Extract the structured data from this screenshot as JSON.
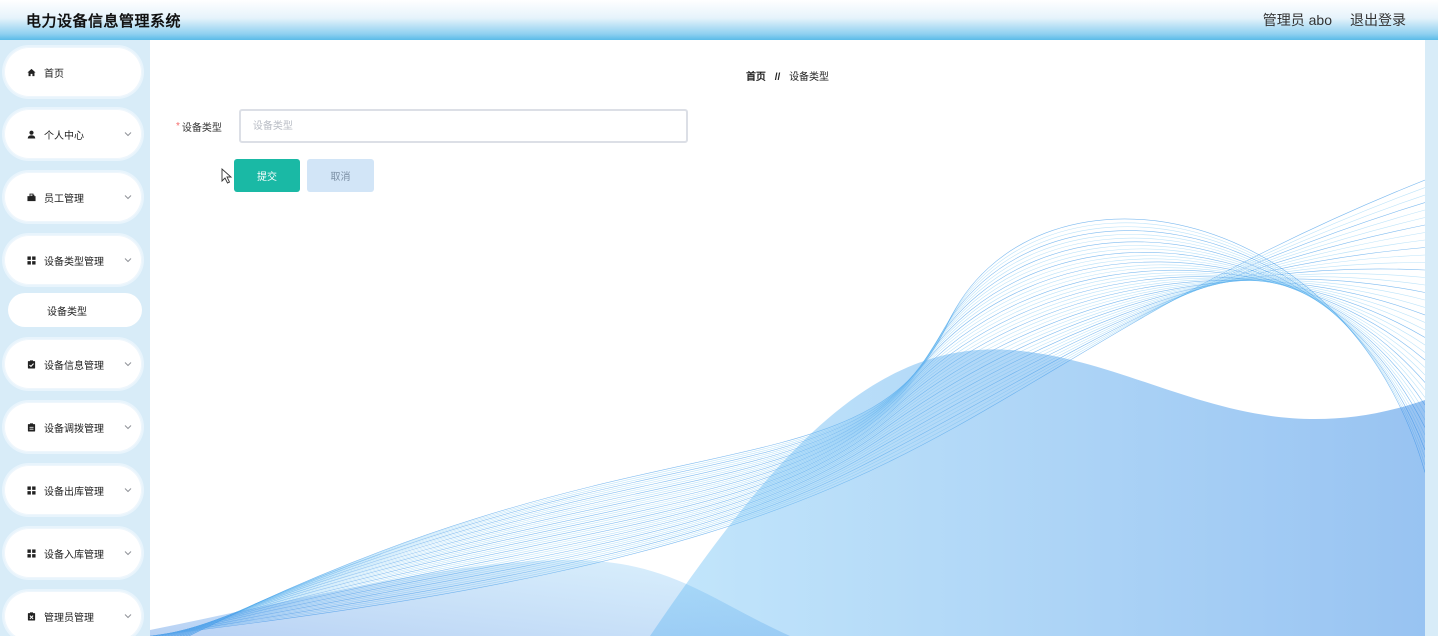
{
  "header": {
    "app_title": "电力设备信息管理系统",
    "user_label": "管理员 abo",
    "logout_label": "退出登录"
  },
  "sidebar": {
    "items": [
      {
        "label": "首页",
        "icon": "home-icon"
      },
      {
        "label": "个人中心",
        "icon": "user-icon"
      },
      {
        "label": "员工管理",
        "icon": "briefcase-icon"
      },
      {
        "label": "设备类型管理",
        "icon": "grid-icon"
      },
      {
        "label": "设备信息管理",
        "icon": "clipboard-check-icon"
      },
      {
        "label": "设备调拨管理",
        "icon": "clipboard-list-icon"
      },
      {
        "label": "设备出库管理",
        "icon": "grid-icon"
      },
      {
        "label": "设备入库管理",
        "icon": "grid-icon"
      },
      {
        "label": "管理员管理",
        "icon": "clipboard-x-icon"
      }
    ],
    "submenu": {
      "label": "设备类型"
    }
  },
  "breadcrumb": {
    "home": "首页",
    "separator": "//",
    "current": "设备类型"
  },
  "form": {
    "required_mark": "*",
    "field_label": "设备类型",
    "field_value": "",
    "field_placeholder": "设备类型",
    "submit_label": "提交",
    "cancel_label": "取消"
  },
  "colors": {
    "accent": "#1ab9a5",
    "cancel_bg": "#d2e5f7",
    "sidebar_bg": "#d8ecf8",
    "header_gradient_end": "#5bbbe8",
    "wave_blue": "#2b8fe6"
  }
}
